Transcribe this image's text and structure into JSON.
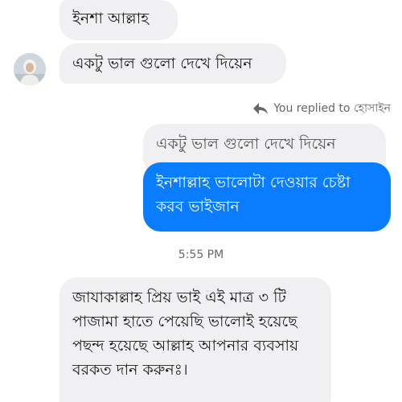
{
  "messages": {
    "m1": "ইনশা আল্লাহ",
    "m2": "একটু ভাল গুলো দেখে দিয়েন",
    "replied_label": "You replied to হোসাইন",
    "quoted": "একটু ভাল গুলো দেখে দিয়েন",
    "m3": "ইনশাল্লাহ ভালোটা দেওয়ার চেষ্টা করব ভাইজান",
    "timestamp": "5:55 PM",
    "m4": "জাযাকাল্লাহ প্রিয় ভাই এই মাত্র ৩ টি পাজামা হাতে পেয়েছি ভালোই হয়েছে পছন্দ হয়েছে আল্লাহ আপনার ব্যবসায় বরকত দান করুনঃ।"
  },
  "colors": {
    "incoming_bubble": "#f0f0f2",
    "outgoing_bubble": "#0a7cff",
    "meta_text": "#65676b"
  },
  "icons": {
    "reply": "reply-arrow-icon",
    "avatar": "user-avatar"
  }
}
